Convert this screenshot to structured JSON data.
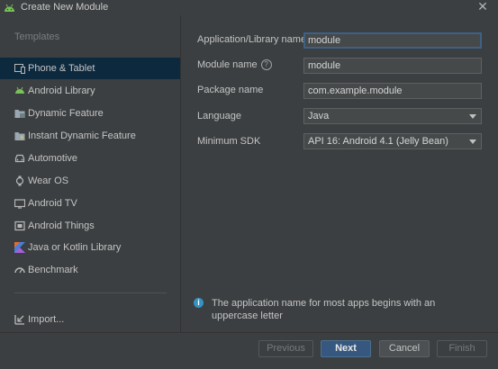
{
  "window": {
    "title": "Create New Module"
  },
  "sidebar": {
    "header": "Templates",
    "items": [
      {
        "label": "Phone & Tablet",
        "icon": "phone-tablet-icon",
        "selected": true
      },
      {
        "label": "Android Library",
        "icon": "android-icon"
      },
      {
        "label": "Dynamic Feature",
        "icon": "folder-feature-icon"
      },
      {
        "label": "Instant Dynamic Feature",
        "icon": "folder-instant-icon"
      },
      {
        "label": "Automotive",
        "icon": "car-icon"
      },
      {
        "label": "Wear OS",
        "icon": "watch-icon"
      },
      {
        "label": "Android TV",
        "icon": "tv-icon"
      },
      {
        "label": "Android Things",
        "icon": "chip-icon"
      },
      {
        "label": "Java or Kotlin Library",
        "icon": "kotlin-icon"
      },
      {
        "label": "Benchmark",
        "icon": "gauge-icon"
      }
    ],
    "import_label": "Import..."
  },
  "form": {
    "app_name_label": "Application/Library name",
    "app_name_value": "module",
    "module_name_label": "Module name",
    "module_name_value": "module",
    "package_label": "Package name",
    "package_value": "com.example.module",
    "language_label": "Language",
    "language_value": "Java",
    "min_sdk_label": "Minimum SDK",
    "min_sdk_value": "API 16: Android 4.1 (Jelly Bean)"
  },
  "info": {
    "text": "The application name for most apps begins with an uppercase letter"
  },
  "buttons": {
    "previous": "Previous",
    "next": "Next",
    "cancel": "Cancel",
    "finish": "Finish"
  },
  "colors": {
    "background": "#3c3f41",
    "selection": "#0d293e",
    "accent": "#365880",
    "android_green": "#78c257",
    "info_blue": "#3592c4"
  }
}
